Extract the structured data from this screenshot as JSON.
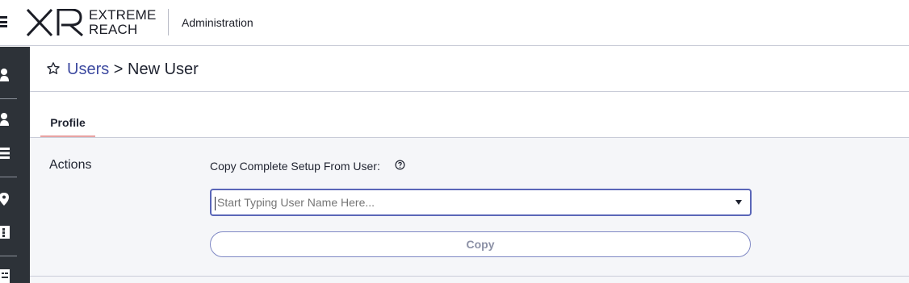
{
  "header": {
    "brand_line1": "EXTREME",
    "brand_line2": "REACH",
    "app_name": "Administration",
    "logo_icon": "xr-logo",
    "menu_icon": "hamburger-icon"
  },
  "sidebar": {
    "items": [
      {
        "icon": "user-icon"
      },
      {
        "icon": "user-icon"
      },
      {
        "icon": "list-icon"
      },
      {
        "icon": "location-pin-icon"
      },
      {
        "icon": "film-icon"
      },
      {
        "icon": "id-card-icon"
      }
    ]
  },
  "breadcrumb": {
    "parent": "Users",
    "separator": ">",
    "current": "New User"
  },
  "tabs": [
    {
      "label": "Profile",
      "active": true
    }
  ],
  "actions": {
    "section_title": "Actions",
    "copy_label": "Copy Complete Setup From User:",
    "search_placeholder": "Start Typing User Name Here...",
    "copy_button": "Copy"
  },
  "colors": {
    "sidebar": "#2d3238",
    "link": "#3d4aa0",
    "tab_underline": "#e8a3a3",
    "input_border": "#5a66b8",
    "content_bg": "#f5f6f9"
  }
}
